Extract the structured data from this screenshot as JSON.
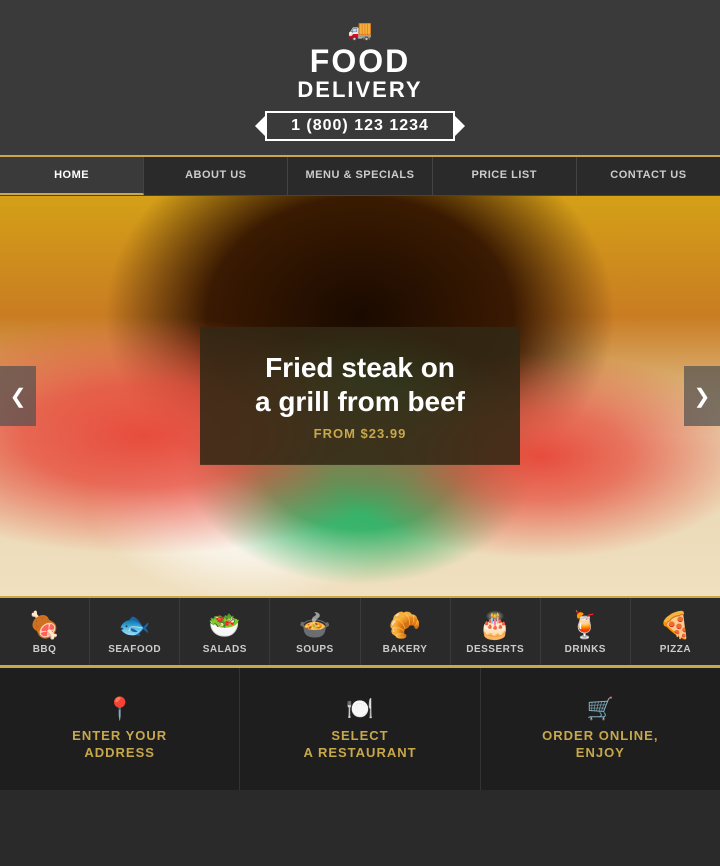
{
  "header": {
    "truck_icon": "🚚",
    "line1": "FOOD",
    "line2": "DELIVERY",
    "phone": "1 (800) 123 1234"
  },
  "nav": {
    "items": [
      {
        "label": "HOME",
        "active": true
      },
      {
        "label": "ABOUT US",
        "active": false
      },
      {
        "label": "MENU & SPECIALS",
        "active": false
      },
      {
        "label": "PRICE LIST",
        "active": false
      },
      {
        "label": "CONTACT US",
        "active": false
      }
    ]
  },
  "hero": {
    "title_line1": "Fried steak on",
    "title_line2": "a grill from beef",
    "price_label": "FROM $23.99",
    "arrow_left": "❮",
    "arrow_right": "❯"
  },
  "categories": [
    {
      "label": "BBQ",
      "icon": "🍖"
    },
    {
      "label": "SEAFOOD",
      "icon": "🐟"
    },
    {
      "label": "SALADS",
      "icon": "🥗"
    },
    {
      "label": "SOUPS",
      "icon": "🍲"
    },
    {
      "label": "BAKERY",
      "icon": "🥐"
    },
    {
      "label": "DESSERTS",
      "icon": "🎂"
    },
    {
      "label": "DRINKS",
      "icon": "🍹"
    },
    {
      "label": "PIZZA",
      "icon": "🍕"
    }
  ],
  "steps": [
    {
      "icon": "📍",
      "title_line1": "ENTER YOUR",
      "title_line2": "ADDRESS"
    },
    {
      "icon": "🍽️",
      "title_line1": "SELECT",
      "title_line2": "A RESTAURANT"
    },
    {
      "icon": "🛒",
      "title_line1": "ORDER ONLINE,",
      "title_line2": "ENJOY"
    }
  ]
}
